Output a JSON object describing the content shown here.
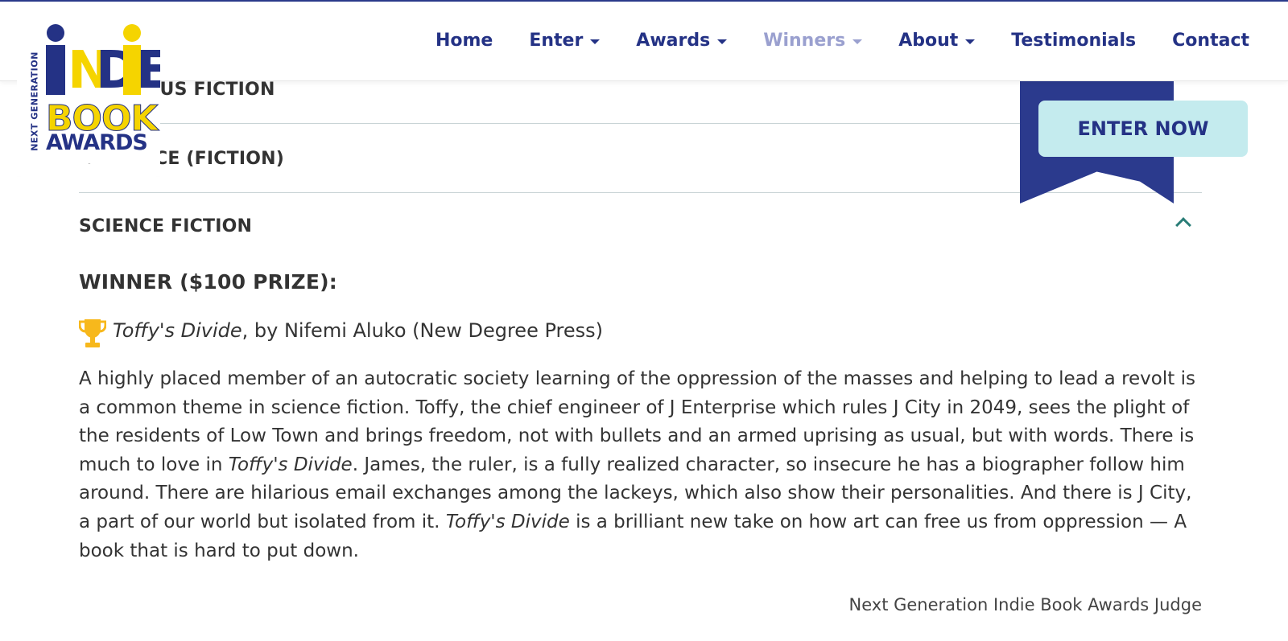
{
  "nav": {
    "home": "Home",
    "enter": "Enter",
    "awards": "Awards",
    "winners": "Winners",
    "about": "About",
    "testimonials": "Testimonials",
    "contact": "Contact"
  },
  "logo": {
    "side_text": "NEXT GENERATION",
    "indie": "INDIE",
    "book": "BOOK",
    "awards": "AWARDS"
  },
  "cta": {
    "enter_now": "ENTER NOW"
  },
  "accordion": {
    "item1": "RELIGIOUS FICTION",
    "item2": "ROMANCE (FICTION)",
    "item3": "SCIENCE FICTION"
  },
  "winner": {
    "heading": "WINNER ($100 PRIZE):",
    "book_title": "Toffy's Divide",
    "book_credit": ", by Nifemi Aluko (New Degree Press)"
  },
  "review": {
    "part1": "A highly placed member of an autocratic society learning of the oppression of the masses and helping to lead a revolt is a common theme in science fiction. Toffy, the chief engineer of J Enterprise which rules J City in 2049, sees the plight of the residents of Low Town and brings freedom, not with bullets and an armed uprising as usual, but with words. There is much to love in ",
    "title1": "Toffy's Divide",
    "part2": ". James, the ruler, is a fully realized character, so insecure he has a biographer follow him around. There are hilarious email exchanges among the lackeys, which also show their personalities. And there is J City, a part of our world but isolated from it. ",
    "title2": "Toffy's Divide",
    "part3": " is a brilliant new take on how art can free us from oppression — A book that is hard to put down."
  },
  "judge": "Next Generation Indie Book Awards Judge",
  "colors": {
    "brand_navy": "#243285",
    "brand_yellow": "#f5d400",
    "nav_active": "#9aa0cf",
    "button_bg": "#c4ebee",
    "ribbon": "#2b3a8d",
    "trophy": "#f7b81c",
    "chevron": "#2a7d77"
  }
}
